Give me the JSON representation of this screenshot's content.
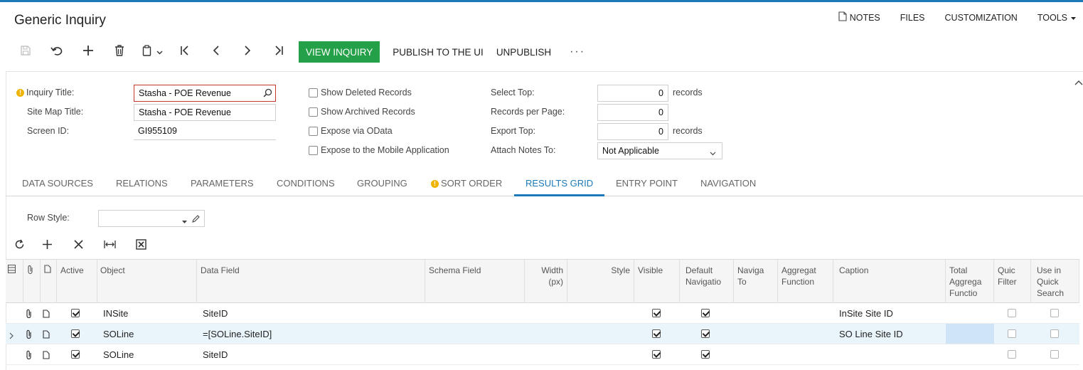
{
  "app": {
    "title": "Generic Inquiry"
  },
  "top_menu": {
    "notes": "NOTES",
    "files": "FILES",
    "customization": "CUSTOMIZATION",
    "tools": "TOOLS"
  },
  "toolbar": {
    "icons": [
      "save-icon",
      "undo-icon",
      "plus-icon",
      "trash-icon",
      "copy-paste-icon",
      "first-icon",
      "prev-icon",
      "next-icon",
      "last-icon"
    ],
    "view_inquiry": "VIEW INQUIRY",
    "publish": "PUBLISH TO THE UI",
    "unpublish": "UNPUBLISH",
    "more": "···"
  },
  "form": {
    "inquiry_title_label": "Inquiry Title:",
    "inquiry_title_value": "Stasha - POE Revenue",
    "site_map_title_label": "Site Map Title:",
    "site_map_title_value": "Stasha - POE Revenue",
    "screen_id_label": "Screen ID:",
    "screen_id_value": "GI955109",
    "show_deleted": "Show Deleted Records",
    "show_archived": "Show Archived Records",
    "expose_odata": "Expose via OData",
    "expose_mobile": "Expose to the Mobile Application",
    "select_top_label": "Select Top:",
    "select_top_value": "0",
    "records_per_page_label": "Records per Page:",
    "records_per_page_value": "0",
    "export_top_label": "Export Top:",
    "export_top_value": "0",
    "records_unit": "records",
    "attach_notes_label": "Attach Notes To:",
    "attach_notes_value": "Not Applicable"
  },
  "tabs": [
    "DATA SOURCES",
    "RELATIONS",
    "PARAMETERS",
    "CONDITIONS",
    "GROUPING",
    "SORT ORDER",
    "RESULTS GRID",
    "ENTRY POINT",
    "NAVIGATION"
  ],
  "active_tab": "RESULTS GRID",
  "results_grid": {
    "row_style_label": "Row Style:",
    "row_style_value": "",
    "columns": {
      "active": "Active",
      "object": "Object",
      "data_field": "Data Field",
      "schema_field": "Schema Field",
      "width": "Width (px)",
      "style": "Style",
      "visible": "Visible",
      "default_nav": "Default Navigatio",
      "navigate_to": "Naviga To",
      "aggregate_function": "Aggregat Function",
      "caption": "Caption",
      "total_aggregate": "Total Aggrega Functio",
      "quick_filter": "Quic Filter",
      "quick_search": "Use in Quick Search"
    },
    "rows": [
      {
        "active": true,
        "object": "INSite",
        "data_field": "SiteID",
        "visible": true,
        "default_nav": true,
        "caption": "InSite Site ID",
        "quick_filter": false,
        "quick_search": false
      },
      {
        "active": true,
        "object": "SOLine",
        "data_field": "=[SOLine.SiteID]",
        "visible": true,
        "default_nav": true,
        "caption": "SO Line Site ID",
        "quick_filter": false,
        "quick_search": false
      },
      {
        "active": true,
        "object": "SOLine",
        "data_field": "SiteID",
        "visible": true,
        "default_nav": true,
        "caption": "",
        "quick_filter": false,
        "quick_search": false
      }
    ]
  }
}
